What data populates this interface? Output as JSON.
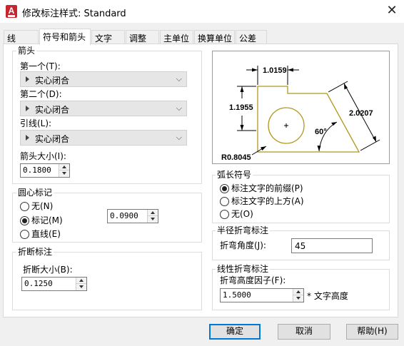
{
  "window": {
    "title": "修改标注样式: Standard",
    "close_glyph": "✕",
    "app_icon_letter": "A"
  },
  "tabs": [
    {
      "label": "线",
      "active": false
    },
    {
      "label": "符号和箭头",
      "active": true
    },
    {
      "label": "文字",
      "active": false
    },
    {
      "label": "调整",
      "active": false
    },
    {
      "label": "主单位",
      "active": false
    },
    {
      "label": "换算单位",
      "active": false
    },
    {
      "label": "公差",
      "active": false
    }
  ],
  "arrowheads": {
    "group_label": "箭头",
    "first_label": "第一个(T):",
    "first_value": "实心闭合",
    "second_label": "第二个(D):",
    "second_value": "实心闭合",
    "leader_label": "引线(L):",
    "leader_value": "实心闭合",
    "size_label": "箭头大小(I):",
    "size_value": "0.1800"
  },
  "center_marks": {
    "group_label": "圆心标记",
    "options": [
      {
        "label": "无(N)",
        "selected": false
      },
      {
        "label": "标记(M)",
        "selected": true
      },
      {
        "label": "直线(E)",
        "selected": false
      }
    ],
    "size_value": "0.0900"
  },
  "dimension_break": {
    "group_label": "折断标注",
    "size_label": "折断大小(B):",
    "size_value": "0.1250"
  },
  "preview": {
    "dim_top": "1.0159",
    "dim_left": "1.1955",
    "dim_right": "2.0207",
    "angle": "60°",
    "radius": "R0.8045",
    "line_color": "#b3961b"
  },
  "arc_length_symbol": {
    "group_label": "弧长符号",
    "options": [
      {
        "label": "标注文字的前缀(P)",
        "selected": true
      },
      {
        "label": "标注文字的上方(A)",
        "selected": false
      },
      {
        "label": "无(O)",
        "selected": false
      }
    ]
  },
  "radius_jog": {
    "group_label": "半径折弯标注",
    "angle_label": "折弯角度(J):",
    "angle_value": "45"
  },
  "linear_jog": {
    "group_label": "线性折弯标注",
    "factor_label": "折弯高度因子(F):",
    "factor_value": "1.5000",
    "suffix": "* 文字高度"
  },
  "buttons": {
    "ok": "确定",
    "cancel": "取消",
    "help": "帮助(H)"
  },
  "colors": {
    "accent": "#0078d7",
    "app_icon": "#c8262e"
  }
}
